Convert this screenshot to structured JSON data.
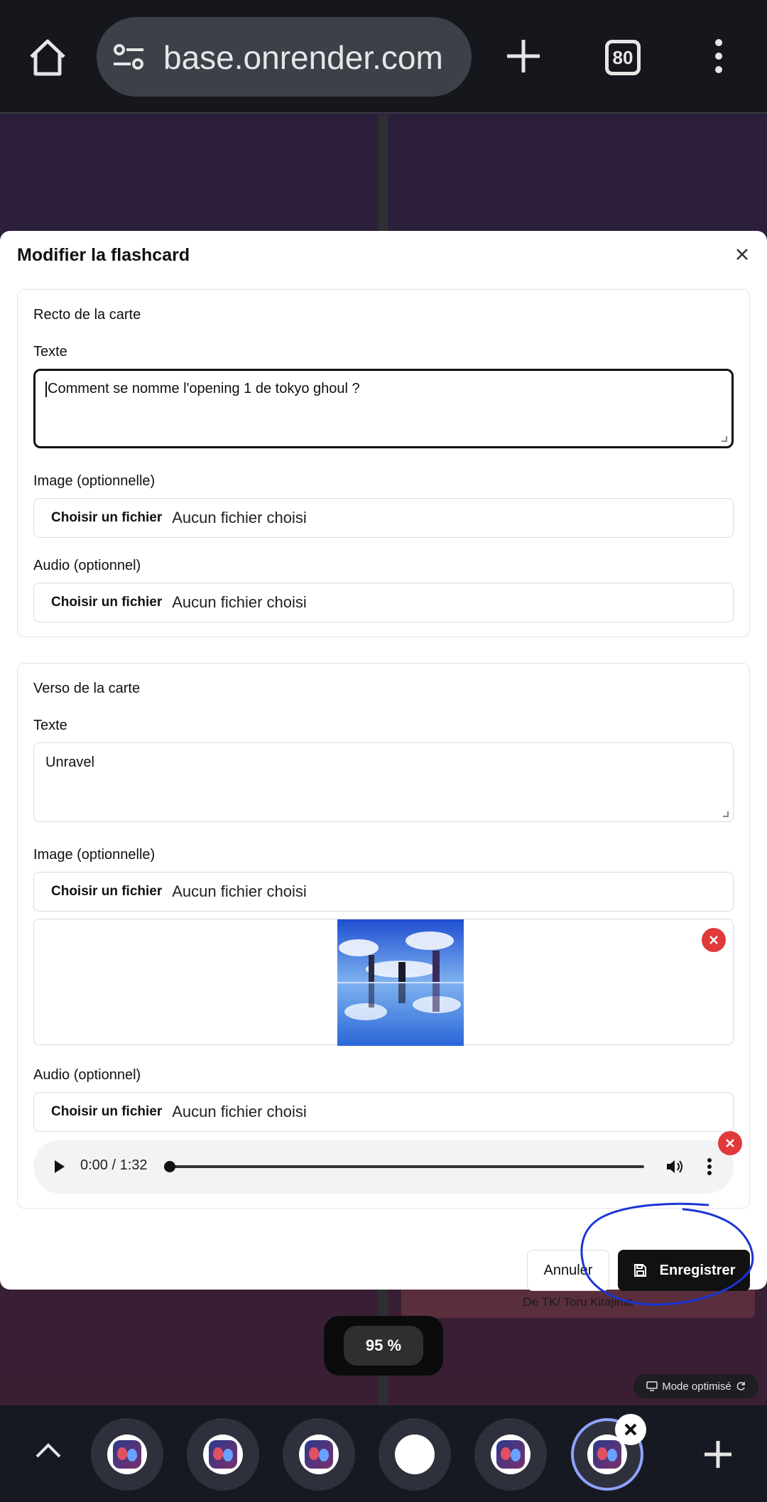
{
  "browser": {
    "url": "base.onrender.com",
    "tab_count": "80",
    "icons": [
      "home-icon",
      "site-settings-icon",
      "new-tab-icon",
      "tab-switcher-icon",
      "more-vert-icon"
    ]
  },
  "modal": {
    "title": "Modifier la flashcard",
    "recto": {
      "section_title": "Recto de la carte",
      "text_label": "Texte",
      "text_value": "Comment se nomme l'opening 1 de tokyo ghoul ?",
      "image_label": "Image (optionnelle)",
      "audio_label": "Audio (optionnel)"
    },
    "verso": {
      "section_title": "Verso de la carte",
      "text_label": "Texte",
      "text_value": "Unravel",
      "image_label": "Image (optionnelle)",
      "audio_label": "Audio (optionnel)",
      "audio_time": "0:00 / 1:32"
    },
    "file_input": {
      "button_label": "Choisir un fichier",
      "status": "Aucun fichier choisi"
    },
    "cancel_label": "Annuler",
    "save_label": "Enregistrer"
  },
  "background": {
    "card_caption": "De TK/ Toru Kitajima"
  },
  "zoom": {
    "value": "95 %"
  },
  "mode_pill": {
    "label": "Mode optimisé"
  },
  "colors": {
    "annotation": "#1a35d6",
    "remove": "#e03a3a",
    "save_button": "#111111",
    "tab_ring": "#8fa3ff"
  }
}
